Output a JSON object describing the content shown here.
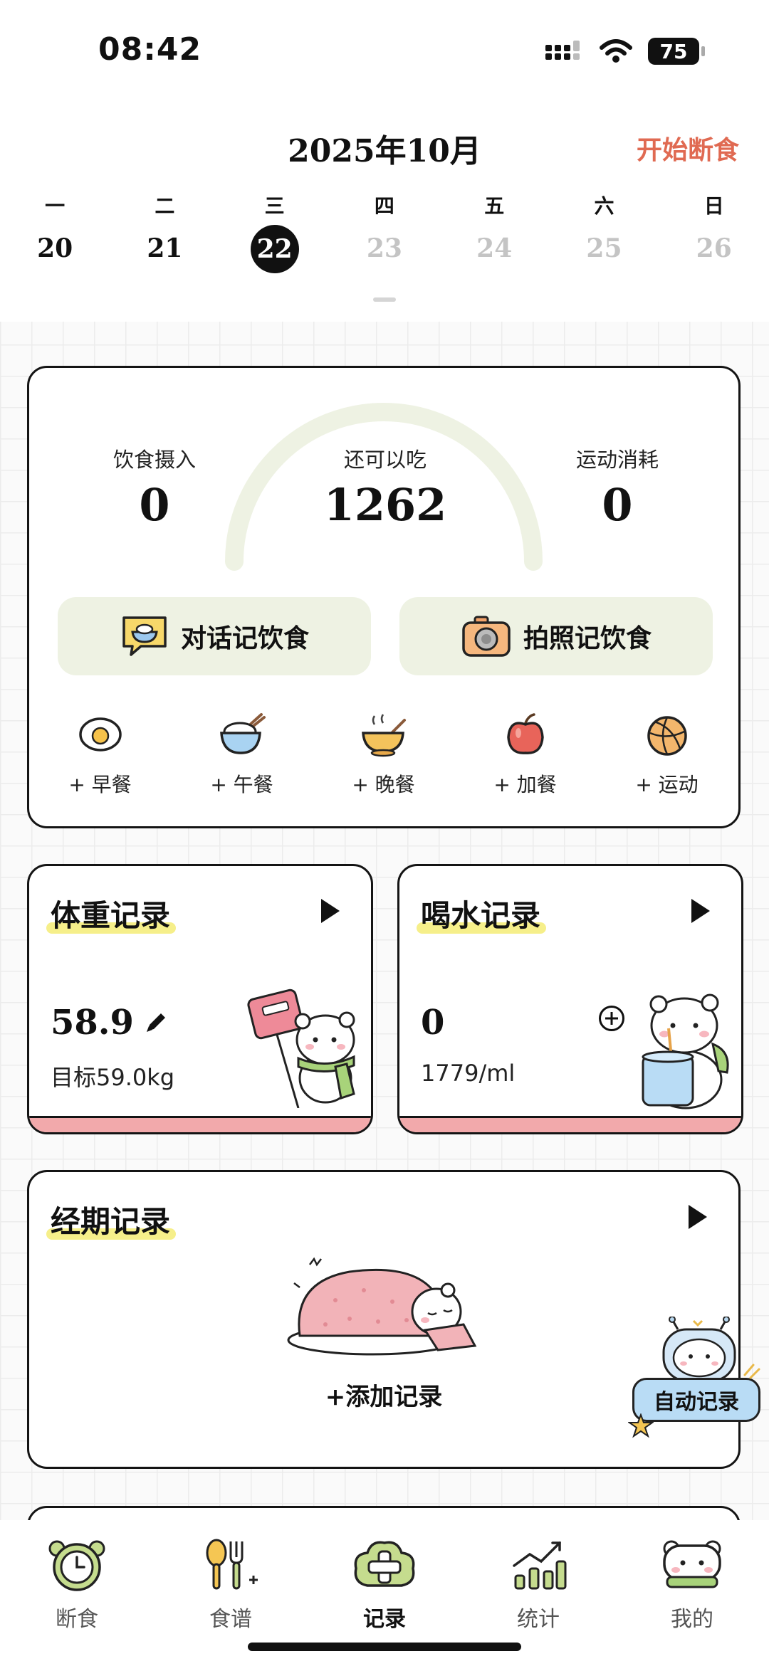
{
  "status_bar": {
    "time": "08:42",
    "battery": "75"
  },
  "header": {
    "month_title": "2025年10月",
    "start_fasting": "开始断食",
    "weekdays": [
      "一",
      "二",
      "三",
      "四",
      "五",
      "六",
      "日"
    ],
    "dates": [
      "20",
      "21",
      "22",
      "23",
      "24",
      "25",
      "26"
    ],
    "selected_date": "22"
  },
  "intake": {
    "intake_label": "饮食摄入",
    "intake_value": "0",
    "remaining_label": "还可以吃",
    "remaining_value": "1262",
    "burned_label": "运动消耗",
    "burned_value": "0",
    "chat_button": "对话记饮食",
    "photo_button": "拍照记饮食",
    "meals": [
      "+ 早餐",
      "+ 午餐",
      "+ 晚餐",
      "+ 加餐",
      "+ 运动"
    ]
  },
  "weight": {
    "title": "体重记录",
    "value": "58.9",
    "target": "目标59.0kg"
  },
  "water": {
    "title": "喝水记录",
    "value": "0",
    "target": "1779/ml"
  },
  "period": {
    "title": "经期记录",
    "add_label": "+添加记录"
  },
  "auto_record": "自动记录",
  "tabs": [
    "断食",
    "食谱",
    "记录",
    "统计",
    "我的"
  ],
  "active_tab": "记录",
  "colors": {
    "accent": "#e06a52",
    "button_bg": "#eef2e3",
    "card_strip": "#f2a9ab",
    "highlight": "#f6ef8a",
    "gauge": "#eef2e3"
  }
}
